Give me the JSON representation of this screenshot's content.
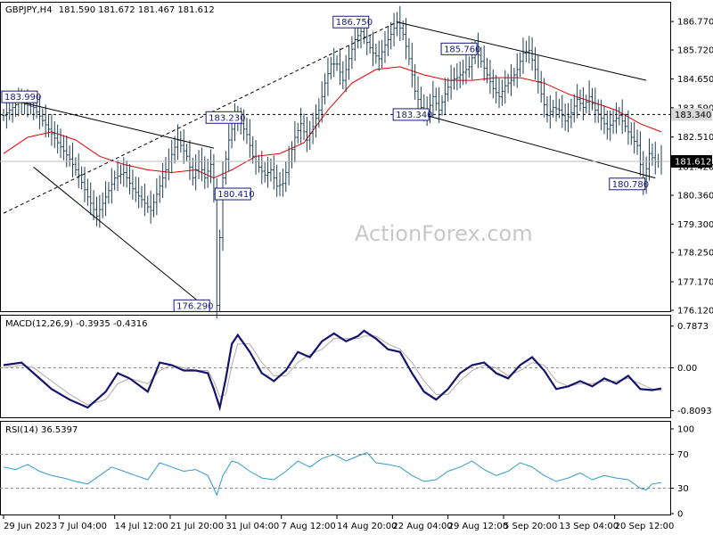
{
  "chart_data": {
    "type": "candlestick",
    "header": {
      "symbol": "GBPJPY,H4",
      "ohlc": "181.590 181.672 181.467 181.612"
    },
    "watermark": "ActionForex.com",
    "price_axis": {
      "ylim": [
        176.12,
        187.3
      ],
      "ticks": [
        "186.770",
        "185.720",
        "184.650",
        "183.590",
        "182.510",
        "181.420",
        "180.360",
        "179.300",
        "178.250",
        "177.170",
        "176.120"
      ],
      "current_price": "181.612",
      "hline_price": "183.340"
    },
    "x_ticks": [
      "29 Jun 2023",
      "7 Jul 04:00",
      "14 Jul 12:00",
      "21 Jul 20:00",
      "31 Jul 04:00",
      "7 Aug 12:00",
      "14 Aug 20:00",
      "22 Aug 04:00",
      "29 Aug 12:00",
      "5 Sep 20:00",
      "13 Sep 04:00",
      "20 Sep 12:00"
    ],
    "price_path": [
      [
        0,
        183.3
      ],
      [
        5,
        183.8
      ],
      [
        10,
        183.6
      ],
      [
        15,
        182.8
      ],
      [
        18,
        182.3
      ],
      [
        22,
        181.7
      ],
      [
        25,
        181.1
      ],
      [
        28,
        180.3
      ],
      [
        31,
        179.6
      ],
      [
        34,
        180.3
      ],
      [
        37,
        181.0
      ],
      [
        40,
        181.2
      ],
      [
        43,
        180.6
      ],
      [
        46,
        180.2
      ],
      [
        49,
        179.8
      ],
      [
        52,
        180.7
      ],
      [
        55,
        181.6
      ],
      [
        58,
        182.4
      ],
      [
        61,
        181.8
      ],
      [
        63,
        181.0
      ],
      [
        65,
        181.6
      ],
      [
        67,
        181.0
      ],
      [
        69,
        181.5
      ],
      [
        70,
        180.4
      ],
      [
        71,
        176.3
      ],
      [
        72,
        178.8
      ],
      [
        73,
        181.0
      ],
      [
        75,
        182.4
      ],
      [
        77,
        183.2
      ],
      [
        79,
        183.0
      ],
      [
        81,
        182.6
      ],
      [
        83,
        181.8
      ],
      [
        85,
        181.4
      ],
      [
        87,
        181.1
      ],
      [
        89,
        181.3
      ],
      [
        91,
        180.7
      ],
      [
        93,
        180.8
      ],
      [
        95,
        181.6
      ],
      [
        97,
        182.5
      ],
      [
        99,
        183.0
      ],
      [
        101,
        182.4
      ],
      [
        103,
        182.9
      ],
      [
        105,
        183.5
      ],
      [
        107,
        184.5
      ],
      [
        109,
        185.2
      ],
      [
        111,
        185.2
      ],
      [
        113,
        184.6
      ],
      [
        115,
        185.4
      ],
      [
        117,
        186.1
      ],
      [
        119,
        186.4
      ],
      [
        121,
        186.0
      ],
      [
        123,
        185.6
      ],
      [
        125,
        185.4
      ],
      [
        127,
        185.9
      ],
      [
        129,
        186.3
      ],
      [
        131,
        186.75
      ],
      [
        133,
        186.3
      ],
      [
        135,
        185.4
      ],
      [
        137,
        184.2
      ],
      [
        139,
        183.6
      ],
      [
        141,
        183.35
      ],
      [
        143,
        184.0
      ],
      [
        145,
        183.5
      ],
      [
        147,
        184.1
      ],
      [
        149,
        184.6
      ],
      [
        151,
        184.7
      ],
      [
        153,
        184.9
      ],
      [
        155,
        185.1
      ],
      [
        157,
        185.76
      ],
      [
        159,
        185.3
      ],
      [
        161,
        184.8
      ],
      [
        163,
        184.3
      ],
      [
        165,
        184.0
      ],
      [
        167,
        184.4
      ],
      [
        169,
        184.6
      ],
      [
        171,
        185.0
      ],
      [
        173,
        185.6
      ],
      [
        175,
        185.7
      ],
      [
        177,
        185.0
      ],
      [
        179,
        184.1
      ],
      [
        181,
        183.3
      ],
      [
        183,
        183.6
      ],
      [
        185,
        183.5
      ],
      [
        187,
        183.1
      ],
      [
        189,
        183.4
      ],
      [
        191,
        183.9
      ],
      [
        193,
        183.6
      ],
      [
        195,
        184.0
      ],
      [
        197,
        183.5
      ],
      [
        199,
        183.2
      ],
      [
        201,
        182.8
      ],
      [
        203,
        183.1
      ],
      [
        205,
        183.3
      ],
      [
        207,
        182.9
      ],
      [
        209,
        182.5
      ],
      [
        211,
        182.2
      ],
      [
        213,
        180.78
      ],
      [
        215,
        181.9
      ],
      [
        217,
        181.6
      ],
      [
        219,
        181.612
      ]
    ],
    "ma_path": [
      [
        0,
        181.9
      ],
      [
        8,
        182.5
      ],
      [
        16,
        182.7
      ],
      [
        24,
        182.4
      ],
      [
        32,
        181.8
      ],
      [
        40,
        181.5
      ],
      [
        48,
        181.3
      ],
      [
        56,
        181.2
      ],
      [
        64,
        181.3
      ],
      [
        70,
        181.0
      ],
      [
        76,
        181.3
      ],
      [
        84,
        181.8
      ],
      [
        92,
        181.9
      ],
      [
        100,
        182.3
      ],
      [
        108,
        183.5
      ],
      [
        116,
        184.5
      ],
      [
        124,
        185.0
      ],
      [
        132,
        185.1
      ],
      [
        140,
        184.8
      ],
      [
        148,
        184.6
      ],
      [
        156,
        184.6
      ],
      [
        164,
        184.7
      ],
      [
        172,
        184.7
      ],
      [
        180,
        184.5
      ],
      [
        188,
        184.1
      ],
      [
        196,
        183.8
      ],
      [
        204,
        183.5
      ],
      [
        212,
        183.0
      ],
      [
        219,
        182.7
      ]
    ],
    "price_labels": [
      {
        "text": "183.990",
        "i": 0,
        "v": 183.99,
        "side": "right"
      },
      {
        "text": "183.230",
        "i": 68,
        "v": 183.23,
        "side": "right"
      },
      {
        "text": "180.410",
        "i": 71,
        "v": 180.41,
        "side": "right"
      },
      {
        "text": "176.290",
        "i": 68,
        "v": 176.29,
        "side": "left"
      },
      {
        "text": "186.750",
        "i": 121,
        "v": 186.75,
        "side": "left"
      },
      {
        "text": "183.340",
        "i": 141,
        "v": 183.34,
        "side": "left"
      },
      {
        "text": "185.760",
        "i": 157,
        "v": 185.76,
        "side": "left"
      },
      {
        "text": "180.780",
        "i": 213,
        "v": 180.78,
        "side": "left"
      }
    ],
    "trendlines": [
      {
        "p1": [
          0,
          183.95
        ],
        "p2": [
          70,
          182.1
        ]
      },
      {
        "p1": [
          10,
          181.4
        ],
        "p2": [
          66,
          176.35
        ]
      },
      {
        "p1": [
          0,
          179.7
        ],
        "p2": [
          131,
          186.75
        ]
      },
      {
        "p1": [
          131,
          186.75
        ],
        "p2": [
          214,
          184.6
        ]
      },
      {
        "p1": [
          141,
          183.3
        ],
        "p2": [
          217,
          181.0
        ]
      }
    ],
    "macd": {
      "label": "MACD(12,26,9) -0.3935 -0.4316",
      "ylim": [
        -0.9,
        0.85
      ],
      "ticks": [
        "0.7873",
        "0.00",
        "-0.8093"
      ],
      "main": [
        [
          0,
          0.05
        ],
        [
          6,
          0.1
        ],
        [
          10,
          -0.1
        ],
        [
          16,
          -0.4
        ],
        [
          22,
          -0.6
        ],
        [
          28,
          -0.75
        ],
        [
          34,
          -0.45
        ],
        [
          38,
          -0.1
        ],
        [
          42,
          -0.2
        ],
        [
          48,
          -0.45
        ],
        [
          52,
          0.1
        ],
        [
          56,
          0.05
        ],
        [
          60,
          -0.05
        ],
        [
          64,
          -0.05
        ],
        [
          68,
          -0.1
        ],
        [
          70,
          -0.4
        ],
        [
          72,
          -0.75
        ],
        [
          74,
          -0.2
        ],
        [
          76,
          0.45
        ],
        [
          78,
          0.62
        ],
        [
          82,
          0.3
        ],
        [
          86,
          -0.1
        ],
        [
          90,
          -0.25
        ],
        [
          94,
          -0.05
        ],
        [
          98,
          0.3
        ],
        [
          102,
          0.2
        ],
        [
          106,
          0.5
        ],
        [
          110,
          0.65
        ],
        [
          114,
          0.5
        ],
        [
          118,
          0.6
        ],
        [
          120,
          0.7
        ],
        [
          124,
          0.55
        ],
        [
          128,
          0.35
        ],
        [
          132,
          0.3
        ],
        [
          136,
          -0.1
        ],
        [
          140,
          -0.45
        ],
        [
          144,
          -0.6
        ],
        [
          148,
          -0.4
        ],
        [
          152,
          -0.1
        ],
        [
          156,
          0.05
        ],
        [
          160,
          0.1
        ],
        [
          164,
          -0.1
        ],
        [
          168,
          -0.2
        ],
        [
          172,
          0.05
        ],
        [
          176,
          0.2
        ],
        [
          180,
          -0.05
        ],
        [
          184,
          -0.4
        ],
        [
          188,
          -0.35
        ],
        [
          192,
          -0.25
        ],
        [
          196,
          -0.35
        ],
        [
          200,
          -0.2
        ],
        [
          204,
          -0.3
        ],
        [
          208,
          -0.15
        ],
        [
          212,
          -0.4
        ],
        [
          216,
          -0.42
        ],
        [
          219,
          -0.39
        ]
      ],
      "signal": [
        [
          0,
          0.0
        ],
        [
          6,
          0.05
        ],
        [
          10,
          0.0
        ],
        [
          16,
          -0.25
        ],
        [
          22,
          -0.5
        ],
        [
          28,
          -0.7
        ],
        [
          34,
          -0.6
        ],
        [
          38,
          -0.3
        ],
        [
          42,
          -0.2
        ],
        [
          48,
          -0.3
        ],
        [
          52,
          -0.05
        ],
        [
          56,
          0.05
        ],
        [
          60,
          0.0
        ],
        [
          64,
          -0.05
        ],
        [
          68,
          -0.05
        ],
        [
          70,
          -0.25
        ],
        [
          72,
          -0.55
        ],
        [
          74,
          -0.5
        ],
        [
          76,
          0.05
        ],
        [
          78,
          0.45
        ],
        [
          82,
          0.45
        ],
        [
          86,
          0.1
        ],
        [
          90,
          -0.15
        ],
        [
          94,
          -0.15
        ],
        [
          98,
          0.1
        ],
        [
          102,
          0.25
        ],
        [
          106,
          0.35
        ],
        [
          110,
          0.55
        ],
        [
          114,
          0.55
        ],
        [
          118,
          0.55
        ],
        [
          120,
          0.6
        ],
        [
          124,
          0.6
        ],
        [
          128,
          0.45
        ],
        [
          132,
          0.35
        ],
        [
          136,
          0.1
        ],
        [
          140,
          -0.25
        ],
        [
          144,
          -0.5
        ],
        [
          148,
          -0.5
        ],
        [
          152,
          -0.25
        ],
        [
          156,
          -0.05
        ],
        [
          160,
          0.05
        ],
        [
          164,
          0.0
        ],
        [
          168,
          -0.15
        ],
        [
          172,
          -0.05
        ],
        [
          176,
          0.1
        ],
        [
          180,
          0.05
        ],
        [
          184,
          -0.25
        ],
        [
          188,
          -0.35
        ],
        [
          192,
          -0.3
        ],
        [
          196,
          -0.3
        ],
        [
          200,
          -0.25
        ],
        [
          204,
          -0.25
        ],
        [
          208,
          -0.2
        ],
        [
          212,
          -0.3
        ],
        [
          216,
          -0.4
        ],
        [
          219,
          -0.43
        ]
      ]
    },
    "rsi": {
      "label": "RSI(14) 36.5397",
      "ylim": [
        0,
        100
      ],
      "ticks": [
        "100",
        "70",
        "30",
        "0"
      ],
      "levels": [
        70,
        30
      ],
      "series": [
        [
          0,
          55
        ],
        [
          4,
          52
        ],
        [
          8,
          58
        ],
        [
          12,
          50
        ],
        [
          16,
          45
        ],
        [
          20,
          42
        ],
        [
          24,
          38
        ],
        [
          28,
          35
        ],
        [
          32,
          45
        ],
        [
          36,
          55
        ],
        [
          40,
          50
        ],
        [
          44,
          45
        ],
        [
          48,
          40
        ],
        [
          52,
          60
        ],
        [
          56,
          55
        ],
        [
          60,
          50
        ],
        [
          64,
          52
        ],
        [
          68,
          45
        ],
        [
          70,
          30
        ],
        [
          71,
          22
        ],
        [
          73,
          45
        ],
        [
          76,
          62
        ],
        [
          78,
          60
        ],
        [
          82,
          50
        ],
        [
          86,
          42
        ],
        [
          90,
          40
        ],
        [
          94,
          50
        ],
        [
          98,
          62
        ],
        [
          102,
          55
        ],
        [
          106,
          65
        ],
        [
          110,
          70
        ],
        [
          114,
          62
        ],
        [
          118,
          68
        ],
        [
          121,
          72
        ],
        [
          124,
          60
        ],
        [
          128,
          58
        ],
        [
          132,
          55
        ],
        [
          136,
          45
        ],
        [
          140,
          38
        ],
        [
          144,
          40
        ],
        [
          148,
          50
        ],
        [
          152,
          55
        ],
        [
          156,
          62
        ],
        [
          160,
          52
        ],
        [
          164,
          45
        ],
        [
          168,
          50
        ],
        [
          172,
          60
        ],
        [
          176,
          55
        ],
        [
          180,
          45
        ],
        [
          184,
          38
        ],
        [
          188,
          42
        ],
        [
          192,
          48
        ],
        [
          196,
          40
        ],
        [
          200,
          45
        ],
        [
          204,
          42
        ],
        [
          208,
          40
        ],
        [
          212,
          30
        ],
        [
          214,
          28
        ],
        [
          216,
          35
        ],
        [
          219,
          36.54
        ]
      ]
    }
  }
}
